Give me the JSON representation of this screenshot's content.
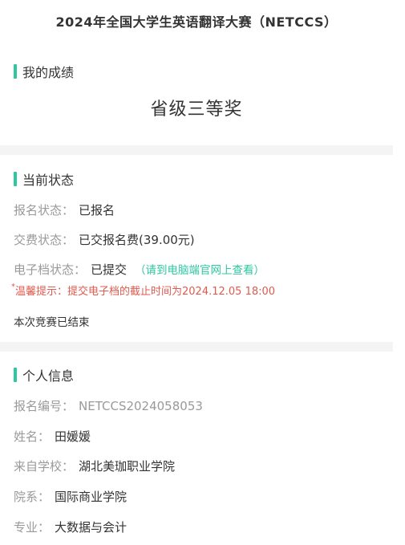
{
  "header": {
    "title": "2024年全国大学生英语翻译大赛（NETCCS）"
  },
  "score_section": {
    "title": "我的成绩",
    "award": "省级三等奖"
  },
  "status_section": {
    "title": "当前状态",
    "registration": {
      "label": "报名状态：",
      "value": "已报名"
    },
    "payment": {
      "label": "交费状态：",
      "value": "已交报名费(39.00元)"
    },
    "e_file": {
      "label": "电子档状态：",
      "value": "已提交",
      "hint": "（请到电脑端官网上查看）"
    },
    "warning_star": "*",
    "warning": "温馨提示：提交电子档的截止时间为2024.12.05 18:00",
    "ended": "本次竞赛已结束"
  },
  "personal_section": {
    "title": "个人信息",
    "reg_no": {
      "label": "报名编号：",
      "value": "NETCCS2024058053"
    },
    "name": {
      "label": "姓名：",
      "value": "田媛媛"
    },
    "school": {
      "label": "来自学校：",
      "value": "湖北美珈职业学院"
    },
    "department": {
      "label": "院系：",
      "value": "国际商业学院"
    },
    "major": {
      "label": "专业：",
      "value": "大数据与会计"
    }
  },
  "colors": {
    "accent": "#2ec7a2",
    "warning": "#e05a4f",
    "label": "#9a9a9a"
  }
}
